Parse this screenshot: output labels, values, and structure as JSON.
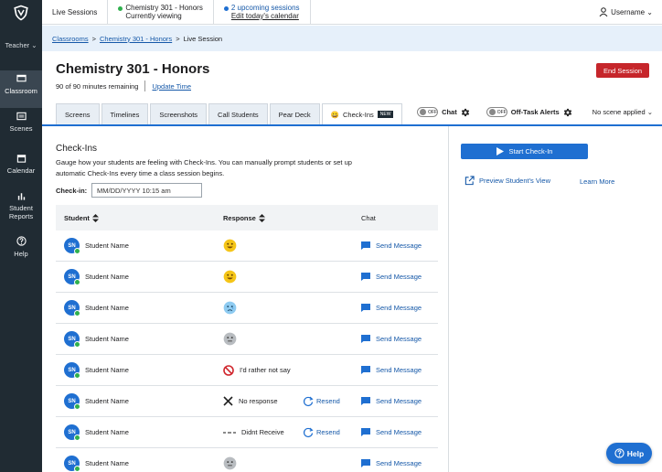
{
  "colors": {
    "sidebar": "#202b33",
    "accent": "#1f6fd1",
    "danger": "#c6262b",
    "online": "#2fb04d",
    "breadcrumb_bg": "#e6f0fa"
  },
  "sidebar": {
    "role": "Teacher ⌄",
    "items": [
      {
        "label": "Classroom",
        "icon": "monitor-icon",
        "active": true
      },
      {
        "label": "Scenes",
        "icon": "scenes-icon",
        "active": false
      },
      {
        "label": "Calendar",
        "icon": "calendar-icon",
        "active": false
      },
      {
        "label": "Student\nReports",
        "icon": "bar-chart-icon",
        "active": false
      },
      {
        "label": "Help",
        "icon": "help-circle-icon",
        "active": false
      }
    ]
  },
  "topbar": {
    "live_sessions": "Live Sessions",
    "current": {
      "title": "Chemistry 301 - Honors",
      "subtitle": "Currently viewing"
    },
    "upcoming": {
      "title": "2 upcoming sessions",
      "subtitle": "Edit today's calendar"
    },
    "user": "Username ⌄"
  },
  "breadcrumb": {
    "items": [
      "Classrooms",
      "Chemistry 301 - Honors"
    ],
    "current": "Live Session",
    "sep": ">"
  },
  "session": {
    "title": "Chemistry 301 - Honors",
    "remaining": "90 of 90 minutes remaining",
    "update_link": "Update Time",
    "end_button": "End Session"
  },
  "tabs": {
    "items": [
      "Screens",
      "Timelines",
      "Screenshots",
      "Call Students",
      "Pear Deck"
    ],
    "active": {
      "label": "Check-Ins",
      "badge": "NEW",
      "emoji": "😀"
    },
    "chat": {
      "label": "Chat",
      "toggle": "OFF"
    },
    "offtask": {
      "label": "Off-Task Alerts",
      "toggle": "OFF"
    },
    "scene": "No scene applied ⌄"
  },
  "checkins": {
    "heading": "Check-Ins",
    "description": "Gauge how your students are feeling with Check-Ins. You can manually prompt students or set up automatic Check-Ins every time a class session begins.",
    "label": "Check-in:",
    "input_value": "MM/DD/YYYY 10:15 am",
    "columns": {
      "student": "Student",
      "response": "Response",
      "chat": "Chat"
    },
    "rows": [
      {
        "initials": "SN",
        "name": "Student Name",
        "response": "happy",
        "text": "",
        "resend": "",
        "chat": "Send Message"
      },
      {
        "initials": "SN",
        "name": "Student Name",
        "response": "happy",
        "text": "",
        "resend": "",
        "chat": "Send Message"
      },
      {
        "initials": "SN",
        "name": "Student Name",
        "response": "sad",
        "text": "",
        "resend": "",
        "chat": "Send Message"
      },
      {
        "initials": "SN",
        "name": "Student Name",
        "response": "neutral",
        "text": "",
        "resend": "",
        "chat": "Send Message"
      },
      {
        "initials": "SN",
        "name": "Student Name",
        "response": "declined",
        "text": "I'd rather not say",
        "resend": "",
        "chat": "Send Message"
      },
      {
        "initials": "SN",
        "name": "Student Name",
        "response": "none",
        "text": "No response",
        "resend": "Resend",
        "chat": "Send Message"
      },
      {
        "initials": "SN",
        "name": "Student Name",
        "response": "not-received",
        "text": "Didnt Receive",
        "resend": "Resend",
        "chat": "Send Message"
      },
      {
        "initials": "SN",
        "name": "Student Name",
        "response": "neutral",
        "text": "",
        "resend": "",
        "chat": "Send Message"
      }
    ]
  },
  "right": {
    "start": "Start Check-In",
    "preview": "Preview Student's View",
    "learn": "Learn More"
  },
  "help_button": "Help"
}
